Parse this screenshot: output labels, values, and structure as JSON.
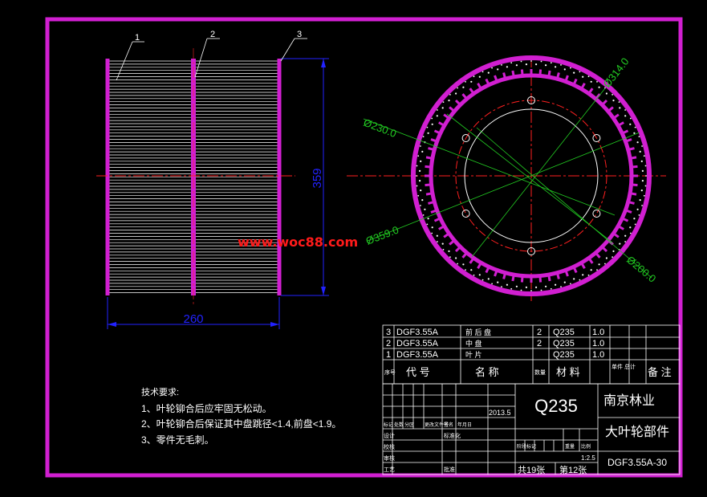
{
  "colors": {
    "background": "#000000",
    "border": "#d11fd1",
    "dimension": "#2222ff",
    "center_line": "#ff2020",
    "leader_green": "#22cc22",
    "outline": "#ffffff",
    "watermark": "#ff1a1a"
  },
  "watermark": "www.woc88.com",
  "part_callouts": [
    "1",
    "2",
    "3"
  ],
  "dimensions": {
    "height": "359",
    "width": "260",
    "d1": "Ø314.0",
    "d2": "Ø230.0",
    "d3": "Ø359.0",
    "d4": "Ø200.0"
  },
  "tech_requirements": {
    "heading": "技术要求:",
    "items": [
      "1、叶轮铆合后应牢固无松动。",
      "2、叶轮铆合后保证其中盘跳径<1.4,前盘<1.9。",
      "3、零件无毛刺。"
    ]
  },
  "parts_list": {
    "rows": [
      {
        "no": "3",
        "code": "DGF3.55A",
        "name": "前 后 盘",
        "qty": "2",
        "material": "Q235",
        "weight": "1.0"
      },
      {
        "no": "2",
        "code": "DGF3.55A",
        "name": "中 盘",
        "qty": "2",
        "material": "Q235",
        "weight": "1.0"
      },
      {
        "no": "1",
        "code": "DGF3.55A",
        "name": "叶 片",
        "qty": "",
        "material": "Q235",
        "weight": "1.0"
      }
    ],
    "header": {
      "no": "序号",
      "code": "代 号",
      "name": "名 称",
      "qty": "数量",
      "material": "材 料",
      "weight": "单件 总计",
      "remark": "备 注"
    }
  },
  "title_block": {
    "material": "Q235",
    "company": "南京林业",
    "part_name": "大叶轮部件",
    "drawing_no": "DGF3.55A-30",
    "date": "2013.5",
    "scale": "1:2.5",
    "sheets_total": "共19张",
    "sheet_no": "第12张",
    "row_labels": [
      "标记",
      "处数",
      "分区",
      "更改文件号",
      "签名",
      "年月日"
    ],
    "design": "设计",
    "standard": "标准化",
    "review": "审核",
    "process": "工艺",
    "approve": "批准",
    "stage": "阶段标记",
    "weight": "重量",
    "ratio": "比例",
    "audit": "校核"
  }
}
